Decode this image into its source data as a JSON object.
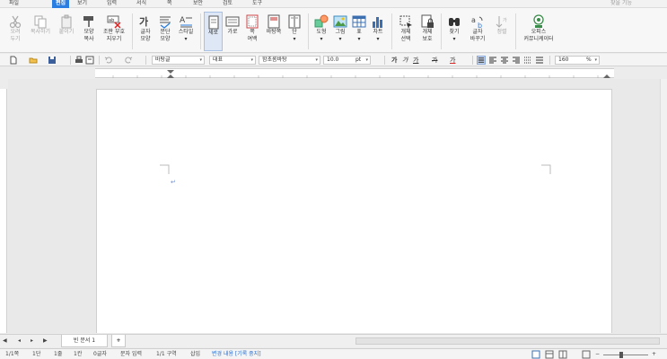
{
  "menubar": {
    "items": [
      "파일",
      "편집",
      "보기",
      "입력",
      "서식",
      "쪽",
      "보안",
      "검토",
      "도구"
    ],
    "active_index": 1,
    "right_text": "찾을 기능"
  },
  "ribbon": {
    "buttons": [
      {
        "label1": "오려",
        "label2": "두기",
        "icon": "scissors-icon",
        "disabled": true
      },
      {
        "label1": "복사하기",
        "label2": "",
        "icon": "copy-icon",
        "disabled": true
      },
      {
        "label1": "붙이기",
        "label2": "",
        "icon": "paste-icon",
        "disabled": true
      },
      {
        "label1": "모양",
        "label2": "복사",
        "icon": "format-painter-icon",
        "disabled": false
      },
      {
        "label1": "조판 부호",
        "label2": "지우기",
        "icon": "clear-marks-icon",
        "disabled": false
      },
      {
        "label1": "글자",
        "label2": "모양",
        "icon": "char-shape-icon",
        "disabled": false
      },
      {
        "label1": "문단",
        "label2": "모양",
        "icon": "paragraph-shape-icon",
        "disabled": false
      },
      {
        "label1": "스타일",
        "label2": "",
        "icon": "style-icon",
        "disabled": false
      },
      {
        "label1": "세로",
        "label2": "",
        "icon": "portrait-icon",
        "disabled": false,
        "selected": true
      },
      {
        "label1": "가로",
        "label2": "",
        "icon": "landscape-icon",
        "disabled": false
      },
      {
        "label1": "쪽",
        "label2": "여백",
        "icon": "page-margin-icon",
        "disabled": false
      },
      {
        "label1": "바탕쪽",
        "label2": "",
        "icon": "master-page-icon",
        "disabled": false
      },
      {
        "label1": "단",
        "label2": "",
        "icon": "columns-icon",
        "disabled": false
      },
      {
        "label1": "도형",
        "label2": "",
        "icon": "shapes-icon",
        "disabled": false
      },
      {
        "label1": "그림",
        "label2": "",
        "icon": "picture-icon",
        "disabled": false
      },
      {
        "label1": "표",
        "label2": "",
        "icon": "table-icon",
        "disabled": false
      },
      {
        "label1": "차트",
        "label2": "",
        "icon": "chart-icon",
        "disabled": false
      },
      {
        "label1": "개체",
        "label2": "선택",
        "icon": "object-select-icon",
        "disabled": false
      },
      {
        "label1": "개체",
        "label2": "보호",
        "icon": "object-protect-icon",
        "disabled": false
      },
      {
        "label1": "찾기",
        "label2": "",
        "icon": "find-icon",
        "disabled": false
      },
      {
        "label1": "글자",
        "label2": "바꾸기",
        "icon": "replace-icon",
        "disabled": false
      },
      {
        "label1": "정렬",
        "label2": "",
        "icon": "sort-icon",
        "disabled": true
      },
      {
        "label1": "오피스",
        "label2": "커뮤니케이터",
        "icon": "communicator-icon",
        "disabled": false
      }
    ]
  },
  "toolbar": {
    "style_combo": "바탕글",
    "lang_combo": "대표",
    "font_combo": "함초롬바탕",
    "size_combo": "10.0",
    "size_unit": "pt",
    "zoom_combo": "160",
    "zoom_unit": "%",
    "bold": "가",
    "italic": "가",
    "underline": "가",
    "strike": "가",
    "color": "가"
  },
  "tabs": {
    "doc_tab": "빈 문서 1",
    "add_tab": "+"
  },
  "status": {
    "page": "1/1쪽",
    "column": "1단",
    "line": "1줄",
    "char": "1칸",
    "chars": "0글자",
    "mode": "문자 입력",
    "section": "1/1 구역",
    "insert": "삽입",
    "track": "변경 내용 [기록 중지]"
  },
  "colors": {
    "accent": "#2a7de1",
    "selected_bg": "#dde7f5",
    "track_text": "#2a6fd1"
  }
}
